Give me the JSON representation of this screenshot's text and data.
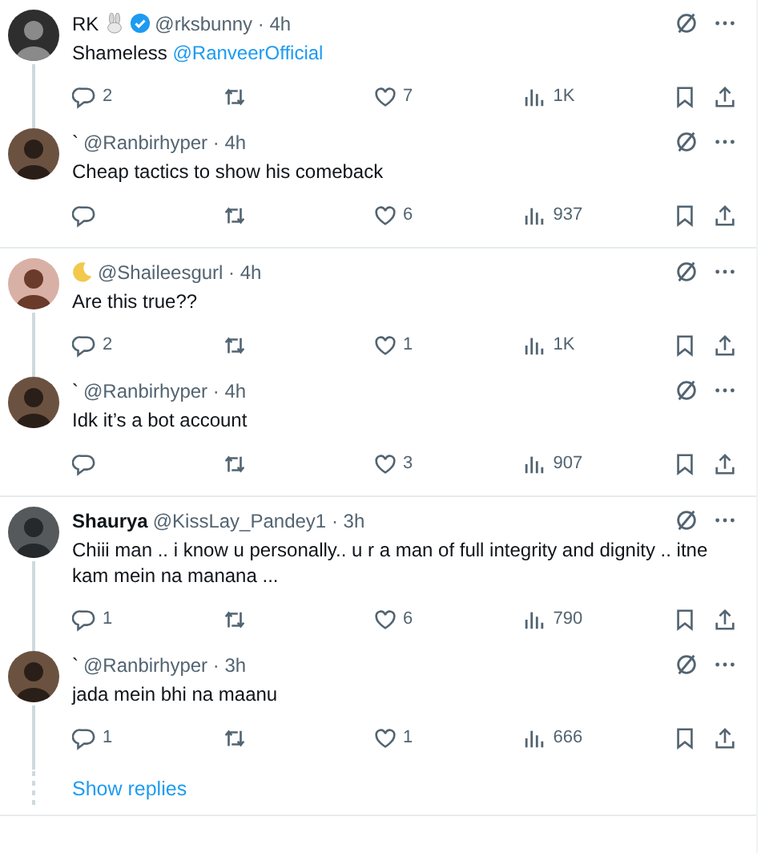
{
  "groups": [
    {
      "tweets": [
        {
          "kind": "bunny",
          "name": "RK",
          "verified": true,
          "meta": "@rksbunny · 4h",
          "text": "Shameless",
          "mention": "@RanveerOfficial",
          "replies": "2",
          "likes": "7",
          "views": "1K"
        },
        {
          "kind": "plain",
          "name": "`",
          "verified": false,
          "meta": "@Ranbirhyper · 4h",
          "text": "Cheap tactics to show his comeback",
          "likes": "6",
          "views": "937"
        }
      ]
    },
    {
      "tweets": [
        {
          "kind": "moon",
          "verified": false,
          "meta": "@Shaileesgurl · 4h",
          "text": "Are this true??",
          "replies": "2",
          "likes": "1",
          "views": "1K"
        },
        {
          "kind": "plain",
          "name": "`",
          "verified": false,
          "meta": "@Ranbirhyper · 4h",
          "text": "Idk it’s a bot account",
          "likes": "3",
          "views": "907"
        }
      ]
    },
    {
      "tweets": [
        {
          "kind": "plain",
          "name": "Shaurya",
          "verified": false,
          "meta": "@KissLay_Pandey1 · 3h",
          "text": "Chiii man .. i know u personally.. u r a man of full integrity and dignity .. itne kam mein na manana ...",
          "replies": "1",
          "likes": "6",
          "views": "790"
        },
        {
          "kind": "plain",
          "name": "`",
          "verified": false,
          "meta": "@Ranbirhyper · 3h",
          "text": "jada mein bhi na maanu",
          "replies": "1",
          "likes": "1",
          "views": "666"
        }
      ],
      "show_replies": "Show replies"
    }
  ]
}
